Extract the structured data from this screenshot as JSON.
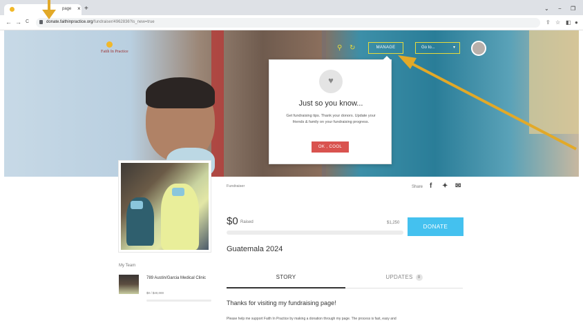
{
  "browser": {
    "tab_title": "page",
    "tab_close": "×",
    "new_tab": "+",
    "url_domain": "donate.faithinpractice.org",
    "url_path": "/fundraiser/4962836?is_new=true",
    "nav_back": "←",
    "nav_forward": "→",
    "nav_reload": "C",
    "win_minimize": "−",
    "win_restore": "❐",
    "win_chevron": "⌄"
  },
  "site": {
    "logo_text": "Faith In Practice",
    "header": {
      "manage_label": "MANAGE",
      "goto_label": "Go to...",
      "goto_caret": "▾"
    }
  },
  "popup": {
    "title": "Just so you know...",
    "body": "Get fundraising tips. Thank your donors. Update your friends & family on your fundraising progress.",
    "ok_label": "OK , COOL",
    "icon": "piggy-bank-icon"
  },
  "fundraiser": {
    "type_label": "Fundraiser",
    "share_label": "Share",
    "raised_amount": "$0",
    "raised_label": "Raised",
    "goal": "$1,250",
    "progress_fraction": 0,
    "donate_label": "DONATE",
    "campaign_name": "Guatemala 2024"
  },
  "team": {
    "label": "My Team",
    "name": "789 Austin/Garcia Medical Clinic",
    "amount": "$0 / $40,000",
    "progress_fraction": 0
  },
  "tabs": {
    "story_label": "STORY",
    "updates_label": "UPDATES",
    "updates_count": "0"
  },
  "story": {
    "heading": "Thanks for visiting my fundraising page!",
    "paragraph": "Please help me support Faith In Practice by making a donation through my page. The process is fast, easy and"
  },
  "colors": {
    "accent_yellow": "#e8dc3a",
    "donate_blue": "#44c1ef",
    "ok_red": "#d9534f",
    "annotation_arrow": "#e2a928"
  }
}
